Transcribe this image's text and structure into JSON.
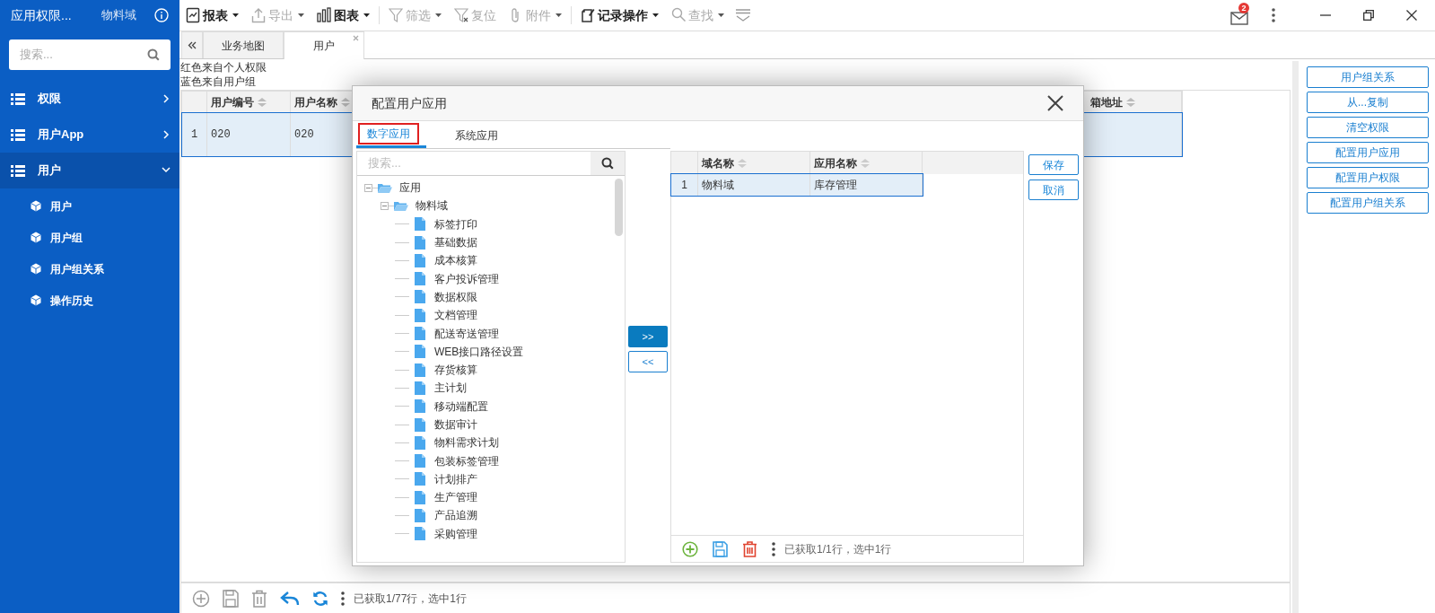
{
  "sidebar": {
    "title": "应用权限...",
    "domain": "物料域",
    "search": {
      "placeholder": "搜索..."
    },
    "items": [
      {
        "label": "权限",
        "expanded": false,
        "selected": false
      },
      {
        "label": "用户App",
        "expanded": false,
        "selected": false
      },
      {
        "label": "用户",
        "expanded": true,
        "selected": true,
        "children": [
          {
            "label": "用户"
          },
          {
            "label": "用户组"
          },
          {
            "label": "用户组关系"
          },
          {
            "label": "操作历史"
          }
        ]
      }
    ]
  },
  "toolbar": {
    "items": [
      {
        "label": "报表",
        "kind": "report",
        "dropdown": true,
        "disabled": false
      },
      {
        "label": "导出",
        "kind": "export",
        "dropdown": true,
        "disabled": true
      },
      {
        "label": "图表",
        "kind": "chart",
        "dropdown": true,
        "disabled": false
      },
      {
        "label": "筛选",
        "kind": "filter",
        "dropdown": true,
        "disabled": true
      },
      {
        "label": "复位",
        "kind": "reset",
        "dropdown": false,
        "disabled": true
      },
      {
        "label": "附件",
        "kind": "attach",
        "dropdown": true,
        "disabled": true
      },
      {
        "label": "记录操作",
        "kind": "record",
        "dropdown": true,
        "disabled": false
      },
      {
        "label": "查找",
        "kind": "search",
        "dropdown": true,
        "disabled": true
      }
    ],
    "mail_badge": "2"
  },
  "tabs": [
    {
      "label": "业务地图",
      "selected": false,
      "closable": false
    },
    {
      "label": "用户",
      "selected": true,
      "closable": true
    }
  ],
  "legend": [
    "红色来自个人权限",
    "蓝色来自用户组"
  ],
  "table": {
    "columns": [
      "用户编号",
      "用户名称",
      "箱地址"
    ],
    "rows": [
      {
        "index": "1",
        "cells": [
          "020",
          "020",
          ""
        ],
        "selected": true
      }
    ]
  },
  "side_buttons": [
    "用户组关系",
    "从...复制",
    "清空权限",
    "配置用户应用",
    "配置用户权限",
    "配置用户组关系"
  ],
  "status": "已获取1/77行，选中1行",
  "dialog": {
    "title": "配置用户应用",
    "tabs": [
      {
        "label": "数字应用",
        "selected": true,
        "outlined": true
      },
      {
        "label": "系统应用",
        "selected": false,
        "outlined": false
      }
    ],
    "search": {
      "placeholder": "搜索..."
    },
    "tree": [
      {
        "label": "应用",
        "expanded": true,
        "children": [
          {
            "label": "物料域",
            "expanded": true,
            "children": [
              {
                "label": "标签打印"
              },
              {
                "label": "基础数据"
              },
              {
                "label": "成本核算"
              },
              {
                "label": "客户投诉管理"
              },
              {
                "label": "数据权限"
              },
              {
                "label": "文档管理"
              },
              {
                "label": "配送寄送管理"
              },
              {
                "label": "WEB接口路径设置"
              },
              {
                "label": "存货核算"
              },
              {
                "label": "主计划"
              },
              {
                "label": "移动端配置"
              },
              {
                "label": "数据审计"
              },
              {
                "label": "物料需求计划"
              },
              {
                "label": "包装标签管理"
              },
              {
                "label": "计划排产"
              },
              {
                "label": "生产管理"
              },
              {
                "label": "产品追溯"
              },
              {
                "label": "采购管理"
              }
            ]
          }
        ]
      }
    ],
    "move_buttons": [
      ">>",
      "<<"
    ],
    "grid": {
      "columns": [
        "域名称",
        "应用名称"
      ],
      "rows": [
        {
          "index": "1",
          "cells": [
            "物料域",
            "库存管理"
          ],
          "selected": true
        }
      ]
    },
    "grid_status": "已获取1/1行，选中1行",
    "buttons": [
      "保存",
      "取消"
    ]
  }
}
